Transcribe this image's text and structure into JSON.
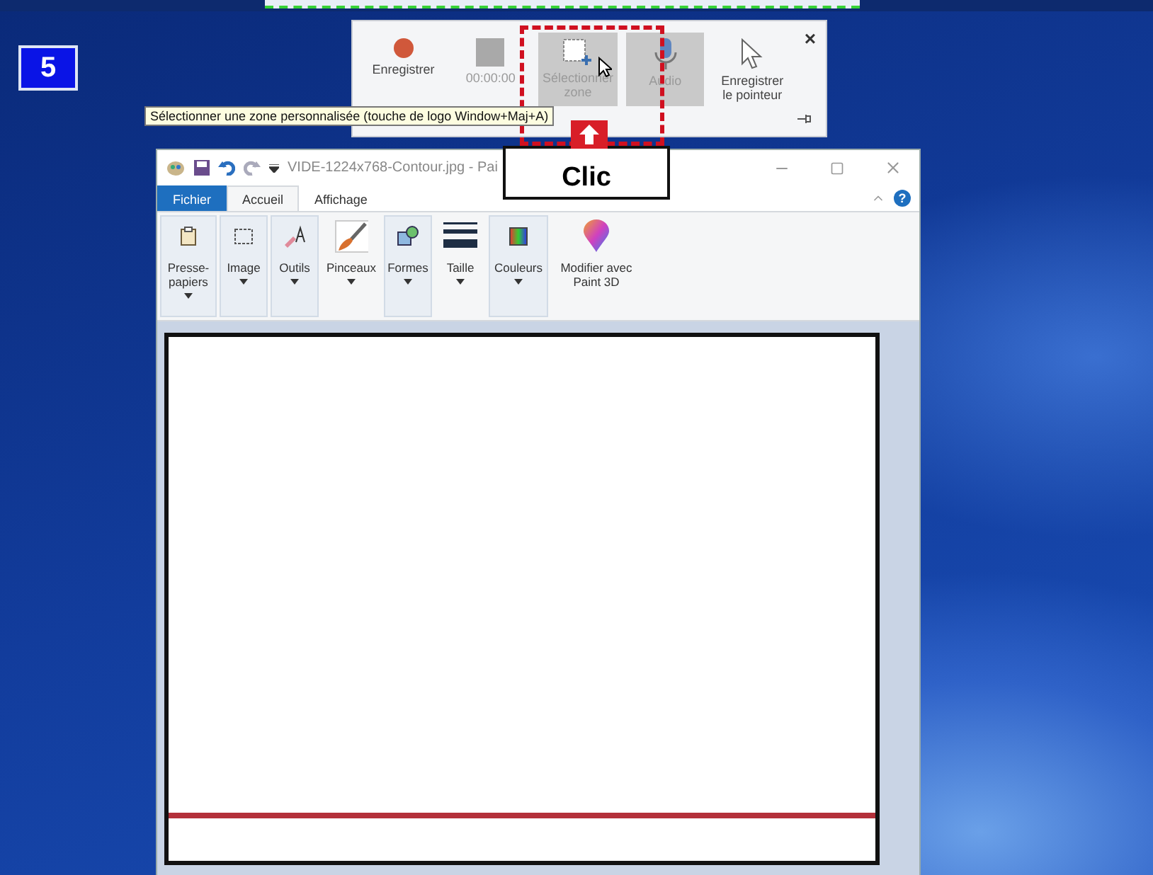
{
  "step_badge": "5",
  "recorder": {
    "close": "×",
    "buttons": [
      {
        "kind": "record",
        "lines": [
          "Enregistrer"
        ],
        "on": false,
        "disabled": false
      },
      {
        "kind": "stop",
        "lines": [
          "00:00:00"
        ],
        "on": false,
        "disabled": true
      },
      {
        "kind": "area",
        "lines": [
          "Sélectionner",
          "zone"
        ],
        "on": true,
        "disabled": true
      },
      {
        "kind": "audio",
        "lines": [
          "Audio"
        ],
        "on": true,
        "disabled": true
      },
      {
        "kind": "pointer",
        "lines": [
          "Enregistrer",
          "le pointeur"
        ],
        "on": false,
        "disabled": false
      }
    ]
  },
  "tooltip": "Sélectionner une zone personnalisée (touche de logo Window+Maj+A)",
  "callout": "Clic",
  "paint": {
    "title": "VIDE-1224x768-Contour.jpg - Pai",
    "help": "?",
    "tabs": [
      {
        "label": "Fichier",
        "kind": "file",
        "selected": false
      },
      {
        "label": "Accueil",
        "kind": "tab",
        "selected": true
      },
      {
        "label": "Affichage",
        "kind": "tab",
        "selected": false
      }
    ],
    "tools": [
      {
        "kind": "clipboard",
        "label": "Presse-papiers",
        "framed": true,
        "dropdown": true
      },
      {
        "kind": "select",
        "label": "Image",
        "framed": true,
        "dropdown": true
      },
      {
        "kind": "tools",
        "label": "Outils",
        "framed": true,
        "dropdown": true
      },
      {
        "kind": "brush",
        "label": "Pinceaux",
        "framed": false,
        "dropdown": true
      },
      {
        "kind": "shapes",
        "label": "Formes",
        "framed": true,
        "dropdown": true
      },
      {
        "kind": "size",
        "label": "Taille",
        "framed": false,
        "dropdown": true
      },
      {
        "kind": "colors",
        "label": "Couleurs",
        "framed": true,
        "dropdown": true
      },
      {
        "kind": "paint3d",
        "label": "Modifier avec Paint 3D",
        "framed": false,
        "dropdown": false
      }
    ]
  }
}
